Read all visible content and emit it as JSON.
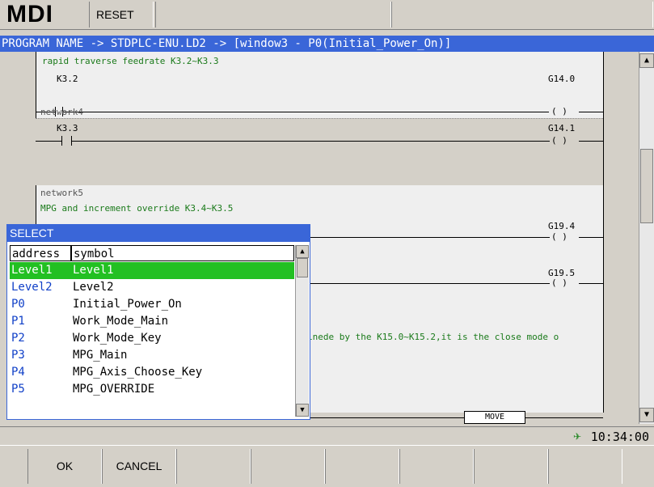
{
  "top": {
    "mode": "MDI",
    "reset": "RESET"
  },
  "titlebar": "PROGRAM NAME -> STDPLC-ENU.LD2 -> [window3 - P0(Initial_Power_On)]",
  "ladder": {
    "comment1": "rapid traverse feedrate K3.2~K3.3",
    "contact1": "K3.2",
    "coil1": "G14.0",
    "network4": "network4",
    "contact2": "K3.3",
    "coil2": "G14.1",
    "network5": "network5",
    "comment2": "MPG and increment override K3.4~K3.5",
    "coil3": "G19.4",
    "coil4": "G19.5",
    "comment3": "inede by the K15.0~K15.2,it is the close mode o",
    "move_label": "MOVE",
    "coil_symbol": "( )"
  },
  "dialog": {
    "title": "SELECT",
    "col_address": "address",
    "col_symbol": "symbol",
    "rows": [
      {
        "address": "Level1",
        "symbol": "Level1"
      },
      {
        "address": "Level2",
        "symbol": "Level2"
      },
      {
        "address": "P0",
        "symbol": "Initial_Power_On"
      },
      {
        "address": "P1",
        "symbol": "Work_Mode_Main"
      },
      {
        "address": "P2",
        "symbol": "Work_Mode_Key"
      },
      {
        "address": "P3",
        "symbol": "MPG_Main"
      },
      {
        "address": "P4",
        "symbol": "MPG_Axis_Choose_Key"
      },
      {
        "address": "P5",
        "symbol": "MPG_OVERRIDE"
      }
    ],
    "selected_index": 0
  },
  "status": {
    "clock": "10:34:00"
  },
  "softkeys": [
    "OK",
    "CANCEL",
    "",
    "",
    "",
    "",
    "",
    ""
  ],
  "colors": {
    "title_blue": "#3a66d8",
    "select_green": "#22c022",
    "comment_green": "#1a7a1a"
  }
}
